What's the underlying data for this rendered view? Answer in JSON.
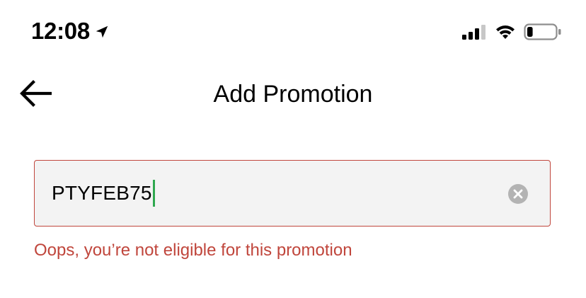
{
  "status_bar": {
    "time": "12:08",
    "icons": [
      "location-arrow-icon",
      "cellular-signal-icon",
      "wifi-icon",
      "battery-icon"
    ],
    "battery_level": 0.2
  },
  "header": {
    "back_icon": "arrow-left-icon",
    "title": "Add Promotion"
  },
  "promo_form": {
    "code_value": "PTYFEB75",
    "clear_icon": "clear-circle-x-icon",
    "error_text": "Oops, you’re not eligible for this promotion"
  },
  "colors": {
    "error": "#c0463c",
    "input_background": "#f3f3f3",
    "caret": "#2fa84f"
  }
}
